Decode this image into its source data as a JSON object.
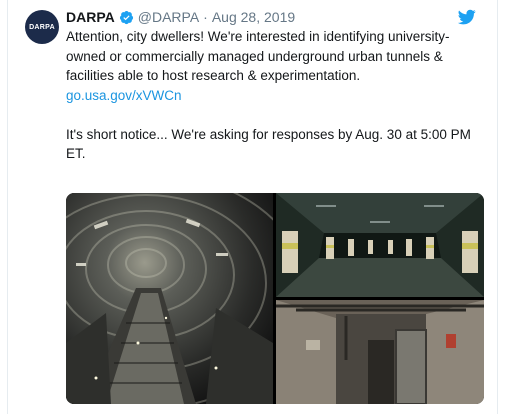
{
  "tweet": {
    "avatar_text": "DARPA",
    "display_name": "DARPA",
    "handle": "@DARPA",
    "separator": "·",
    "date": "Aug 28, 2019",
    "paragraph1": "Attention, city dwellers! We're interested in identifying university-owned or commercially managed underground urban tunnels & facilities able to host research & experimentation.",
    "link": "go.usa.gov/xVWCn",
    "paragraph2": "It's short notice... We're asking for responses by Aug. 30 at 5:00 PM ET."
  },
  "colors": {
    "brand_blue": "#1b95e0",
    "verified_blue": "#1da1f2",
    "muted_text": "#657786",
    "avatar_bg": "#1c2b4a"
  },
  "icons": {
    "verified": "verified-badge-icon",
    "bird": "twitter-bird-icon"
  }
}
